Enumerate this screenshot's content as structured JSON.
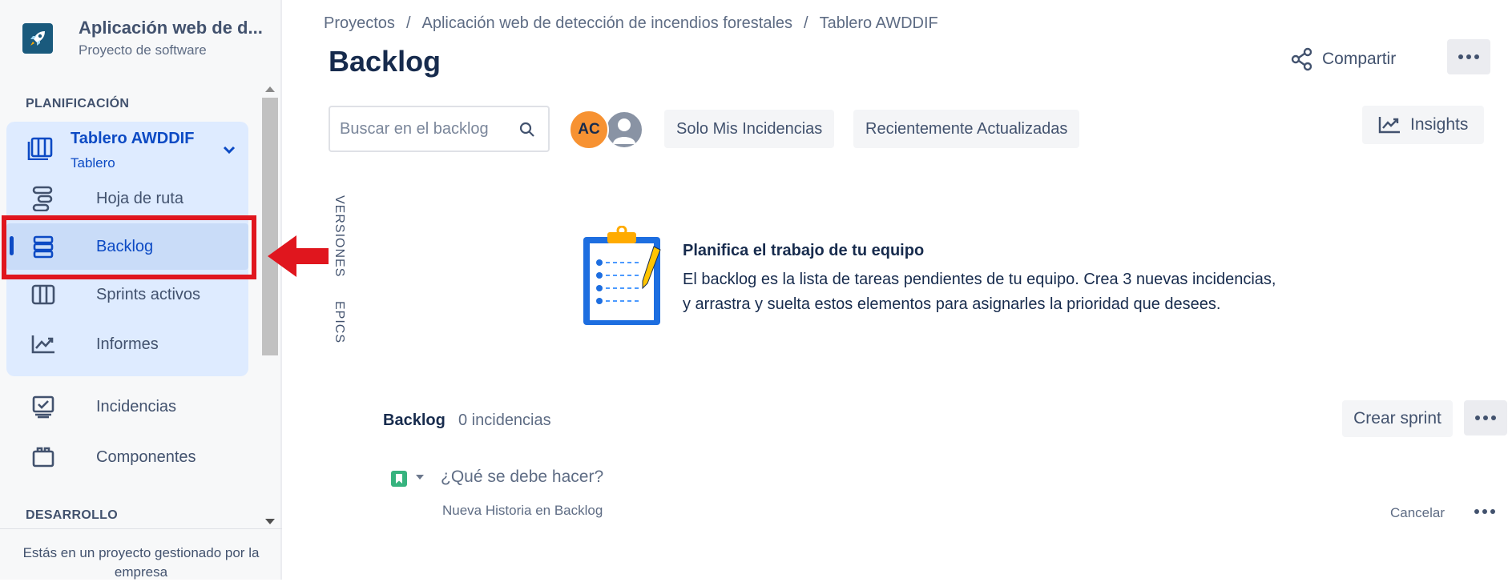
{
  "project": {
    "title": "Aplicación web de d...",
    "type": "Proyecto de software"
  },
  "sidebar": {
    "planning_label": "PLANIFICACIÓN",
    "board": {
      "title": "Tablero AWDDIF",
      "subtitle": "Tablero"
    },
    "items": [
      {
        "label": "Hoja de ruta",
        "icon": "roadmap-icon"
      },
      {
        "label": "Backlog",
        "icon": "backlog-icon",
        "selected": true
      },
      {
        "label": "Sprints activos",
        "icon": "sprints-icon"
      },
      {
        "label": "Informes",
        "icon": "reports-icon"
      },
      {
        "label": "Incidencias",
        "icon": "issues-icon"
      },
      {
        "label": "Componentes",
        "icon": "components-icon"
      }
    ],
    "dev_label": "DESARROLLO",
    "footer": "Estás en un proyecto gestionado por la empresa"
  },
  "breadcrumb": [
    "Proyectos",
    "Aplicación web de detección de incendios forestales",
    "Tablero AWDDIF"
  ],
  "header": {
    "title": "Backlog",
    "share_label": "Compartir"
  },
  "toolbar": {
    "search_placeholder": "Buscar en el backlog",
    "avatar_initials": "AC",
    "filters": [
      "Solo Mis Incidencias",
      "Recientemente Actualizadas"
    ],
    "insights_label": "Insights"
  },
  "side_tabs": {
    "versions": "VERSIONES",
    "epics": "EPICS"
  },
  "empty_state": {
    "title": "Planifica el trabajo de tu equipo",
    "line1": "El backlog es la lista de tareas pendientes de tu equipo. Crea 3 nuevas incidencias,",
    "line2": "y arrastra y suelta estos elementos para asignarles la prioridad que desees."
  },
  "backlog": {
    "title": "Backlog",
    "count": "0 incidencias",
    "create_sprint": "Crear sprint",
    "new_issue_placeholder": "¿Qué se debe hacer?",
    "new_issue_hint": "Nueva Historia en Backlog",
    "cancel_label": "Cancelar"
  },
  "colors": {
    "accent": "#0c4ac4",
    "highlight": "#e0161e",
    "avatar": "#f79232",
    "story": "#36b37e"
  }
}
